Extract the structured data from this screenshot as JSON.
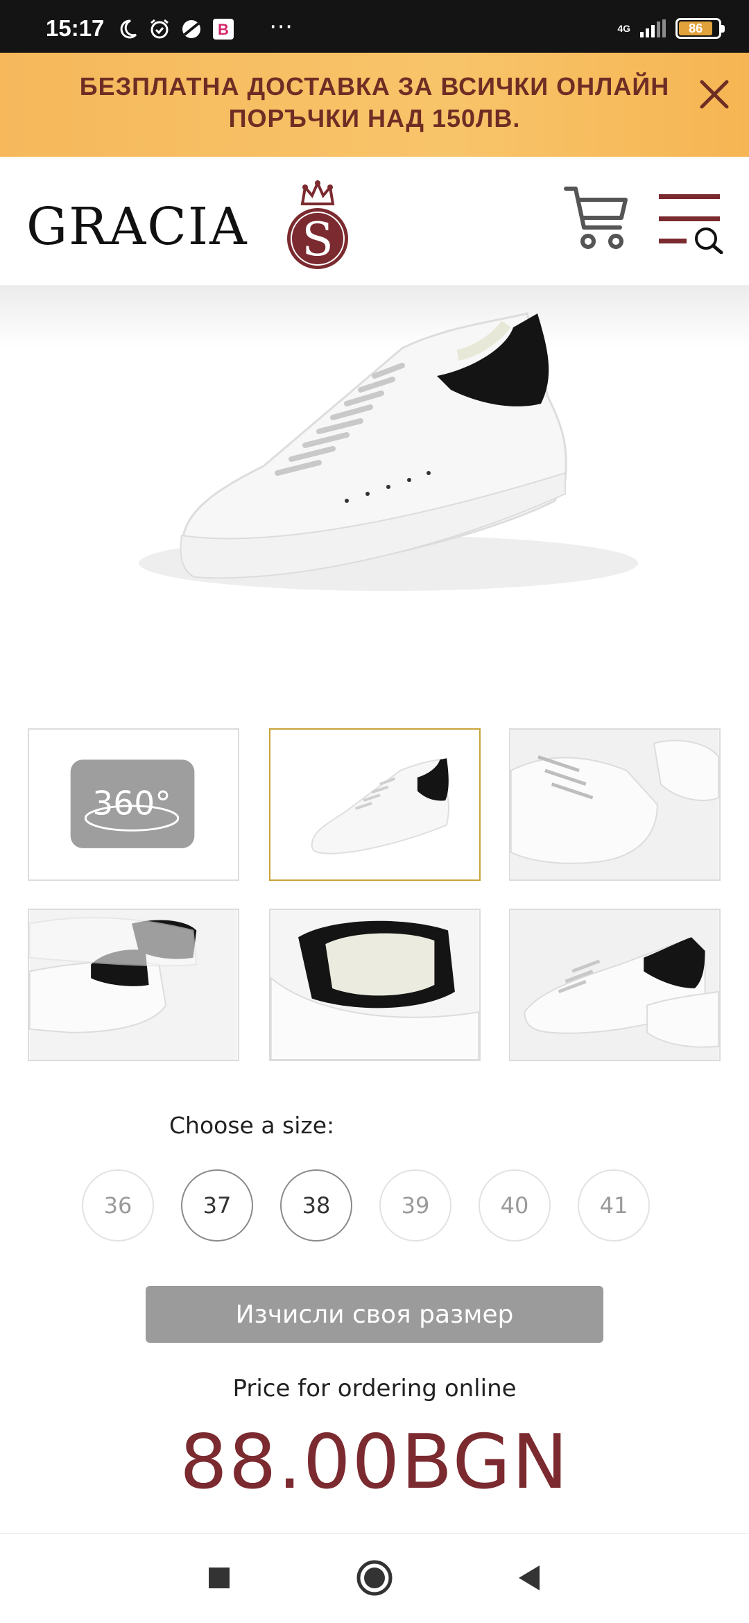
{
  "status_bar": {
    "time": "15:17",
    "network": "4G",
    "battery": "86",
    "more_dots": "⋯",
    "icons": [
      "moon-icon",
      "alarm-icon",
      "sphere-icon",
      "app-b-icon"
    ]
  },
  "promo": {
    "line1": "БЕЗПЛАТНА ДОСТАВКА ЗА ВСИЧКИ ОНЛАЙН",
    "line2": "ПОРЪЧКИ НАД 150ЛВ.",
    "close_icon": "close-icon"
  },
  "header": {
    "logo_text": "GRACIA",
    "logo_badge_letter": "S",
    "cart_icon": "cart-icon",
    "menu_icon": "menu-search-icon"
  },
  "gallery": {
    "thumb_360_label": "360°",
    "active_index": 1
  },
  "size_selector": {
    "label": "Choose a size:",
    "sizes": [
      {
        "value": "36",
        "available": false
      },
      {
        "value": "37",
        "available": true
      },
      {
        "value": "38",
        "available": true
      },
      {
        "value": "39",
        "available": false
      },
      {
        "value": "40",
        "available": false
      },
      {
        "value": "41",
        "available": false
      }
    ]
  },
  "calc_button": "Изчисли своя размер",
  "price": {
    "label": "Price for ordering online",
    "value": "88.00BGN"
  },
  "colors": {
    "promo_bg": "#f8c46a",
    "promo_text": "#6e2d24",
    "brand_red": "#7b2a2f",
    "active_thumb_border": "#c9a43a",
    "button_gray": "#9b9b9b"
  },
  "nav_bar": [
    "recents-button",
    "home-button",
    "back-button"
  ]
}
